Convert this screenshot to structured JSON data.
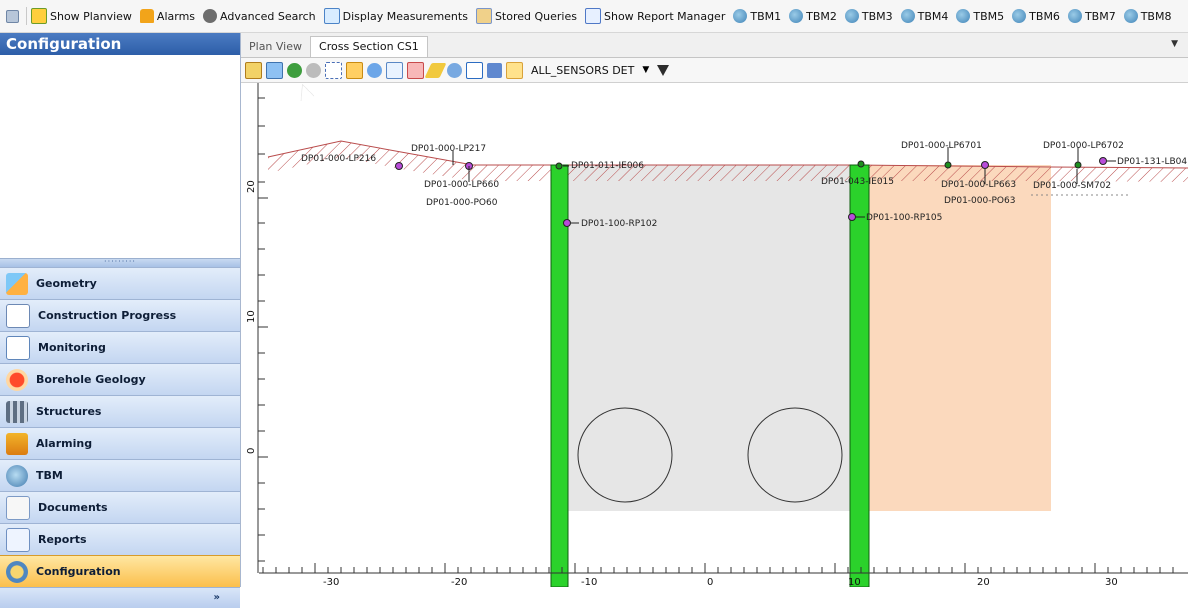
{
  "toolbar": {
    "items": [
      {
        "label": "Show Planview",
        "icon": "planview-icon"
      },
      {
        "label": "Alarms",
        "icon": "alarm-icon"
      },
      {
        "label": "Advanced Search",
        "icon": "binoculars-icon"
      },
      {
        "label": "Display Measurements",
        "icon": "measurements-icon"
      },
      {
        "label": "Stored Queries",
        "icon": "stored-queries-icon"
      },
      {
        "label": "Show Report Manager",
        "icon": "report-manager-icon"
      },
      {
        "label": "TBM1",
        "icon": "tbm-icon"
      },
      {
        "label": "TBM2",
        "icon": "tbm-icon"
      },
      {
        "label": "TBM3",
        "icon": "tbm-icon"
      },
      {
        "label": "TBM4",
        "icon": "tbm-icon"
      },
      {
        "label": "TBM5",
        "icon": "tbm-icon"
      },
      {
        "label": "TBM6",
        "icon": "tbm-icon"
      },
      {
        "label": "TBM7",
        "icon": "tbm-icon"
      },
      {
        "label": "TBM8",
        "icon": "tbm-icon"
      }
    ]
  },
  "left_panel": {
    "title": "Configuration",
    "nav": [
      {
        "label": "Geometry",
        "icon": "geometry-icon",
        "active": false
      },
      {
        "label": "Construction Progress",
        "icon": "construction-progress-icon",
        "active": false
      },
      {
        "label": "Monitoring",
        "icon": "monitoring-icon",
        "active": false
      },
      {
        "label": "Borehole Geology",
        "icon": "borehole-geology-icon",
        "active": false
      },
      {
        "label": "Structures",
        "icon": "structures-icon",
        "active": false
      },
      {
        "label": "Alarming",
        "icon": "alarming-icon",
        "active": false
      },
      {
        "label": "TBM",
        "icon": "tbm-icon",
        "active": false
      },
      {
        "label": "Documents",
        "icon": "documents-icon",
        "active": false
      },
      {
        "label": "Reports",
        "icon": "reports-icon",
        "active": false
      },
      {
        "label": "Configuration",
        "icon": "configuration-icon",
        "active": true
      }
    ],
    "footer_glyph": "»"
  },
  "tabs": [
    {
      "label": "Plan View",
      "active": false
    },
    {
      "label": "Cross Section CS1",
      "active": true
    }
  ],
  "tab_menu": "▼",
  "view_toolbar": {
    "sensor_filter": "ALL_SENSORS DET",
    "caret": "▼"
  },
  "section": {
    "x_ticks": [
      "-30",
      "-20",
      "-10",
      "0",
      "10",
      "20",
      "30"
    ],
    "y_ticks": [
      "20",
      "10",
      "0"
    ],
    "sensors": [
      {
        "label": "DP01-000-LP217"
      },
      {
        "label": "DP01-000-LP216"
      },
      {
        "label": "DP01-000-LP660"
      },
      {
        "label": "DP01-000-PO60"
      },
      {
        "label": "DP01-011-IE006"
      },
      {
        "label": "DP01-100-RP102"
      },
      {
        "label": "DP01-000-LP6701"
      },
      {
        "label": "DP01-000-LP6702"
      },
      {
        "label": "DP01-131-LB04"
      },
      {
        "label": "DP01-043-IE015"
      },
      {
        "label": "DP01-000-LP663"
      },
      {
        "label": "DP01-000-SM702"
      },
      {
        "label": "DP01-000-PO63"
      },
      {
        "label": "DP01-100-RP105"
      }
    ]
  },
  "colors": {
    "wall": "#2bd22b",
    "tunnel_zone": "#e6e6e6",
    "soil_zone": "#fbd9bd",
    "ground_hatch": "#b94c4c",
    "sensor_point": "#b84cd9"
  }
}
